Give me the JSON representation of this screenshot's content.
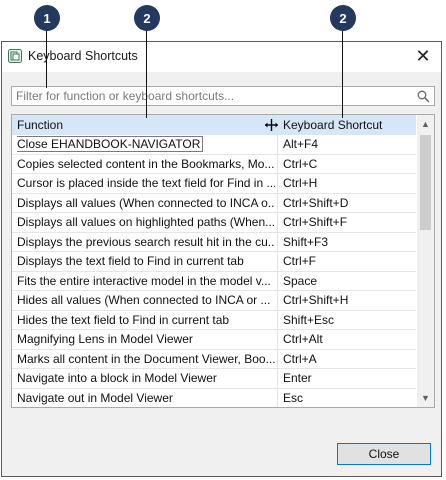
{
  "callouts": [
    "1",
    "2",
    "2"
  ],
  "window": {
    "title": "Keyboard Shortcuts",
    "close_glyph": "✕"
  },
  "filter": {
    "placeholder": "Filter for function or keyboard shortcuts..."
  },
  "table": {
    "headers": {
      "function": "Function",
      "shortcut": "Keyboard Shortcut"
    },
    "rows": [
      {
        "function": "Close EHANDBOOK-NAVIGATOR",
        "shortcut": "Alt+F4"
      },
      {
        "function": "Copies selected content in the Bookmarks, Mo...",
        "shortcut": "Ctrl+C"
      },
      {
        "function": "Cursor is placed inside the text field for Find in ...",
        "shortcut": "Ctrl+H"
      },
      {
        "function": "Displays all values (When connected to INCA o...",
        "shortcut": "Ctrl+Shift+D"
      },
      {
        "function": "Displays all values on highlighted paths (When...",
        "shortcut": "Ctrl+Shift+F"
      },
      {
        "function": "Displays the previous search result hit in the cu...",
        "shortcut": "Shift+F3"
      },
      {
        "function": "Displays the text field to Find in current tab",
        "shortcut": "Ctrl+F"
      },
      {
        "function": "Fits the entire interactive model in the model v...",
        "shortcut": "Space"
      },
      {
        "function": "Hides all values (When connected to INCA or ...",
        "shortcut": "Ctrl+Shift+H"
      },
      {
        "function": "Hides the text field to Find in current tab",
        "shortcut": "Shift+Esc"
      },
      {
        "function": "Magnifying Lens in Model Viewer",
        "shortcut": "Ctrl+Alt"
      },
      {
        "function": "Marks all content in the Document Viewer, Boo...",
        "shortcut": "Ctrl+A"
      },
      {
        "function": "Navigate into a block in Model Viewer",
        "shortcut": "Enter"
      },
      {
        "function": "Navigate out in Model Viewer",
        "shortcut": "Esc"
      }
    ],
    "selected_index": 0
  },
  "buttons": {
    "close": "Close"
  },
  "colors": {
    "header_bg": "#d5e6f7",
    "callout_bg": "#24395f",
    "button_border": "#0078d7"
  }
}
